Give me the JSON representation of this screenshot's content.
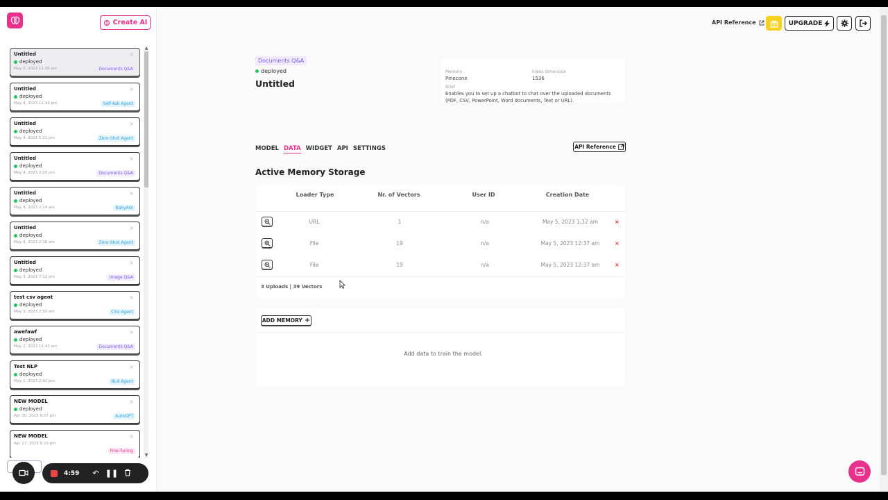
{
  "sidebar": {
    "create_label": "Create AI",
    "models": [
      {
        "name": "Untitled",
        "status": "deployed",
        "date": "May 5, 2023 12:30 am",
        "tag": "Documents Q&A",
        "tag_color": "purple",
        "active": true
      },
      {
        "name": "Untitled",
        "status": "deployed",
        "date": "May 4, 2023 11:44 pm",
        "tag": "Self-Ask Agent",
        "tag_color": "blue"
      },
      {
        "name": "Untitled",
        "status": "deployed",
        "date": "May 4, 2023 5:21 pm",
        "tag": "Zero-Shot Agent",
        "tag_color": "blue"
      },
      {
        "name": "Untitled",
        "status": "deployed",
        "date": "May 4, 2023 2:20 pm",
        "tag": "Documents Q&A",
        "tag_color": "purple"
      },
      {
        "name": "Untitled",
        "status": "deployed",
        "date": "May 4, 2023 2:14 am",
        "tag": "BabyAGI",
        "tag_color": "blue"
      },
      {
        "name": "Untitled",
        "status": "deployed",
        "date": "May 4, 2023 2:10 am",
        "tag": "Zero-Shot Agent",
        "tag_color": "blue"
      },
      {
        "name": "Untitled",
        "status": "deployed",
        "date": "May 3, 2023 7:12 pm",
        "tag": "Image Q&A",
        "tag_color": "purple"
      },
      {
        "name": "test csv agent",
        "status": "deployed",
        "date": "May 3, 2023 2:50 am",
        "tag": "CSV Agent",
        "tag_color": "blue"
      },
      {
        "name": "awefawf",
        "status": "deployed",
        "date": "May 2, 2023 12:43 am",
        "tag": "Documents Q&A",
        "tag_color": "purple"
      },
      {
        "name": "Test NLP",
        "status": "deployed",
        "date": "May 1, 2023 2:42 pm",
        "tag": "NLA Agent",
        "tag_color": "blue"
      },
      {
        "name": "NEW MODEL",
        "status": "deployed",
        "date": "Apr 30, 2023 6:57 pm",
        "tag": "AutoGPT",
        "tag_color": "blue"
      },
      {
        "name": "NEW MODEL",
        "status": "",
        "date": "Apr 27, 2023 6:20 pm",
        "tag": "Fine-Tuning",
        "tag_color": "pink"
      }
    ]
  },
  "header": {
    "api_reference": "API Reference",
    "upgrade": "UPGRADE"
  },
  "model": {
    "type": "Documents Q&A",
    "status": "deployed",
    "title": "Untitled",
    "memory_label": "Memory",
    "memory_value": "Pinecone",
    "index_label": "Index dimension",
    "index_value": "1536",
    "brief_label": "Brief",
    "brief_value": "Enables you to set up a chatbot to chat over the uploaded documents (PDF, CSV, PowerPoint, Word documents, Text or URL)."
  },
  "tabs": [
    "MODEL",
    "DATA",
    "WIDGET",
    "API",
    "SETTINGS"
  ],
  "active_tab": "DATA",
  "api_reference_btn": "API Reference",
  "storage": {
    "title": "Active Memory Storage",
    "columns": [
      "Loader Type",
      "Nr. of Vectors",
      "User ID",
      "Creation Date"
    ],
    "rows": [
      {
        "loader": "URL",
        "vectors": "1",
        "user": "n/a",
        "date": "May 5, 2023 1:32 am"
      },
      {
        "loader": "File",
        "vectors": "19",
        "user": "n/a",
        "date": "May 5, 2023 12:37 am"
      },
      {
        "loader": "File",
        "vectors": "19",
        "user": "n/a",
        "date": "May 5, 2023 12:37 am"
      }
    ],
    "summary": "3 Uploads | 39 Vectors"
  },
  "memory": {
    "add_label": "ADD MEMORY",
    "empty_text": "Add data to train the model."
  },
  "recorder": {
    "time": "4:59"
  }
}
